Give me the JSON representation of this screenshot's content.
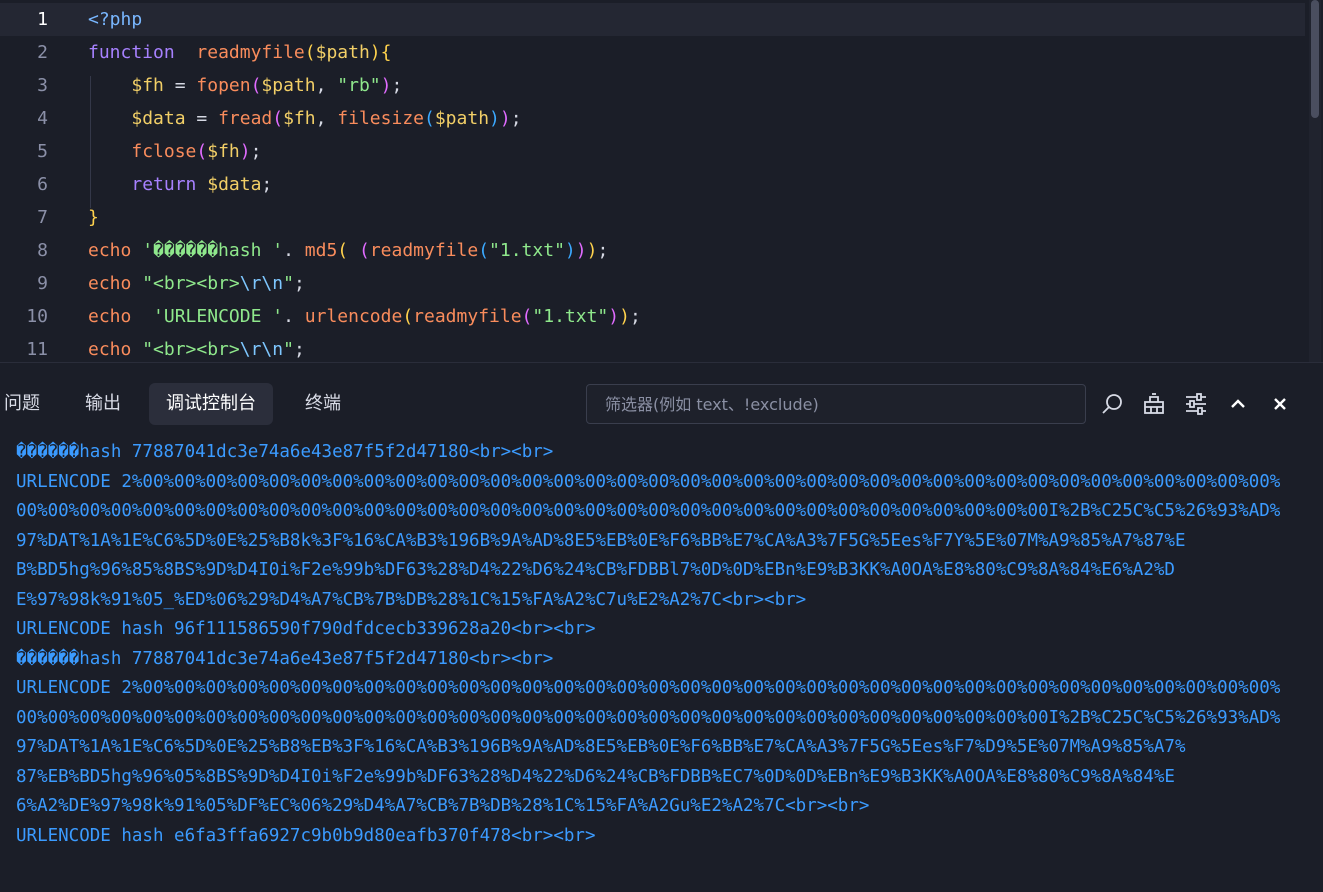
{
  "editor": {
    "current_line": 1,
    "lines": [
      {
        "n": "1",
        "tokens": [
          {
            "t": "<?php",
            "c": "tag"
          }
        ]
      },
      {
        "n": "2",
        "tokens": [
          {
            "t": "function",
            "c": "kw"
          },
          {
            "t": "  ",
            "c": "op"
          },
          {
            "t": "readmyfile",
            "c": "fn"
          },
          {
            "t": "(",
            "c": "b1"
          },
          {
            "t": "$path",
            "c": "var"
          },
          {
            "t": ")",
            "c": "b1"
          },
          {
            "t": "{",
            "c": "b1"
          }
        ]
      },
      {
        "n": "3",
        "tokens": [
          {
            "t": "    ",
            "c": "op"
          },
          {
            "t": "$fh",
            "c": "var"
          },
          {
            "t": " = ",
            "c": "op"
          },
          {
            "t": "fopen",
            "c": "fn"
          },
          {
            "t": "(",
            "c": "b2"
          },
          {
            "t": "$path",
            "c": "var"
          },
          {
            "t": ", ",
            "c": "op"
          },
          {
            "t": "\"rb\"",
            "c": "str"
          },
          {
            "t": ")",
            "c": "b2"
          },
          {
            "t": ";",
            "c": "op"
          }
        ]
      },
      {
        "n": "4",
        "tokens": [
          {
            "t": "    ",
            "c": "op"
          },
          {
            "t": "$data",
            "c": "var"
          },
          {
            "t": " = ",
            "c": "op"
          },
          {
            "t": "fread",
            "c": "fn"
          },
          {
            "t": "(",
            "c": "b2"
          },
          {
            "t": "$fh",
            "c": "var"
          },
          {
            "t": ", ",
            "c": "op"
          },
          {
            "t": "filesize",
            "c": "fn"
          },
          {
            "t": "(",
            "c": "b3"
          },
          {
            "t": "$path",
            "c": "var"
          },
          {
            "t": ")",
            "c": "b3"
          },
          {
            "t": ")",
            "c": "b2"
          },
          {
            "t": ";",
            "c": "op"
          }
        ]
      },
      {
        "n": "5",
        "tokens": [
          {
            "t": "    ",
            "c": "op"
          },
          {
            "t": "fclose",
            "c": "fn"
          },
          {
            "t": "(",
            "c": "b2"
          },
          {
            "t": "$fh",
            "c": "var"
          },
          {
            "t": ")",
            "c": "b2"
          },
          {
            "t": ";",
            "c": "op"
          }
        ]
      },
      {
        "n": "6",
        "tokens": [
          {
            "t": "    ",
            "c": "op"
          },
          {
            "t": "return",
            "c": "kw"
          },
          {
            "t": " ",
            "c": "op"
          },
          {
            "t": "$data",
            "c": "var"
          },
          {
            "t": ";",
            "c": "op"
          }
        ]
      },
      {
        "n": "7",
        "tokens": [
          {
            "t": "}",
            "c": "b1"
          }
        ]
      },
      {
        "n": "8",
        "tokens": [
          {
            "t": "echo",
            "c": "fn"
          },
          {
            "t": " ",
            "c": "op"
          },
          {
            "t": "'������hash '",
            "c": "str"
          },
          {
            "t": ". ",
            "c": "op"
          },
          {
            "t": "md5",
            "c": "fn"
          },
          {
            "t": "(",
            "c": "b1"
          },
          {
            "t": " ",
            "c": "op"
          },
          {
            "t": "(",
            "c": "b2"
          },
          {
            "t": "readmyfile",
            "c": "fn"
          },
          {
            "t": "(",
            "c": "b3"
          },
          {
            "t": "\"1.txt\"",
            "c": "str"
          },
          {
            "t": ")",
            "c": "b3"
          },
          {
            "t": ")",
            "c": "b2"
          },
          {
            "t": ")",
            "c": "b1"
          },
          {
            "t": ";",
            "c": "op"
          }
        ]
      },
      {
        "n": "9",
        "tokens": [
          {
            "t": "echo",
            "c": "fn"
          },
          {
            "t": " ",
            "c": "op"
          },
          {
            "t": "\"<br><br>",
            "c": "str"
          },
          {
            "t": "\\r\\n",
            "c": "esc"
          },
          {
            "t": "\"",
            "c": "str"
          },
          {
            "t": ";",
            "c": "op"
          }
        ]
      },
      {
        "n": "10",
        "tokens": [
          {
            "t": "echo",
            "c": "fn"
          },
          {
            "t": "  ",
            "c": "op"
          },
          {
            "t": "'URLENCODE '",
            "c": "str"
          },
          {
            "t": ". ",
            "c": "op"
          },
          {
            "t": "urlencode",
            "c": "fn"
          },
          {
            "t": "(",
            "c": "b1"
          },
          {
            "t": "readmyfile",
            "c": "fn"
          },
          {
            "t": "(",
            "c": "b2"
          },
          {
            "t": "\"1.txt\"",
            "c": "str"
          },
          {
            "t": ")",
            "c": "b2"
          },
          {
            "t": ")",
            "c": "b1"
          },
          {
            "t": ";",
            "c": "op"
          }
        ]
      },
      {
        "n": "11",
        "tokens": [
          {
            "t": "echo",
            "c": "fn"
          },
          {
            "t": " ",
            "c": "op"
          },
          {
            "t": "\"<br><br>",
            "c": "str"
          },
          {
            "t": "\\r\\n",
            "c": "esc"
          },
          {
            "t": "\"",
            "c": "str"
          },
          {
            "t": ";",
            "c": "op"
          }
        ]
      }
    ]
  },
  "panel": {
    "tabs": [
      {
        "label": "问题",
        "active": false
      },
      {
        "label": "输出",
        "active": false
      },
      {
        "label": "调试控制台",
        "active": true
      },
      {
        "label": "终端",
        "active": false
      }
    ],
    "filter": {
      "placeholder": "筛选器(例如 text、!exclude)",
      "value": ""
    },
    "actions": [
      "search-icon",
      "clear-console-icon",
      "settings-sliders-icon",
      "chevron-up-icon",
      "close-icon"
    ]
  },
  "console": {
    "lines": [
      "������hash 77887041dc3e74a6e43e87f5f2d47180<br><br>",
      "URLENCODE 2%00%00%00%00%00%00%00%00%00%00%00%00%00%00%00%00%00%00%00%00%00%00%00%00%00%00%00%00%00%00%00%00%00%00%00%00%",
      "00%00%00%00%00%00%00%00%00%00%00%00%00%00%00%00%00%00%00%00%00%00%00%00%00%00%00%00%00%00%00%00%00I%2B%C25C%C5%26%93%AD%",
      "97%DAT%1A%1E%C6%5D%0E%25%B8k%3F%16%CA%B3%196B%9A%AD%8E5%EB%0E%F6%BB%E7%CA%A3%7F5G%5Ees%F7Y%5E%07M%A9%85%A7%87%E",
      "B%BD5hg%96%85%8BS%9D%D4I0i%F2e%99b%DF63%28%D4%22%D6%24%CB%FDBBl7%0D%0D%EBn%E9%B3KK%A0OA%E8%80%C9%8A%84%E6%A2%D",
      "E%97%98k%91%05_%ED%06%29%D4%A7%CB%7B%DB%28%1C%15%FA%A2%C7u%E2%A2%7C<br><br>",
      "URLENCODE hash 96f111586590f790dfdcecb339628a20<br><br>",
      "������hash 77887041dc3e74a6e43e87f5f2d47180<br><br>",
      "URLENCODE 2%00%00%00%00%00%00%00%00%00%00%00%00%00%00%00%00%00%00%00%00%00%00%00%00%00%00%00%00%00%00%00%00%00%00%00%00%",
      "00%00%00%00%00%00%00%00%00%00%00%00%00%00%00%00%00%00%00%00%00%00%00%00%00%00%00%00%00%00%00%00%00I%2B%C25C%C5%26%93%AD%",
      "97%DAT%1A%1E%C6%5D%0E%25%B8%EB%3F%16%CA%B3%196B%9A%AD%8E5%EB%0E%F6%BB%E7%CA%A3%7F5G%5Ees%F7%D9%5E%07M%A9%85%A7%",
      "87%EB%BD5hg%96%05%8BS%9D%D4I0i%F2e%99b%DF63%28%D4%22%D6%24%CB%FDBB%EC7%0D%0D%EBn%E9%B3KK%A0OA%E8%80%C9%8A%84%E",
      "6%A2%DE%97%98k%91%05%DF%EC%06%29%D4%A7%CB%7B%DB%28%1C%15%FA%A2Gu%E2%A2%7C<br><br>",
      "URLENCODE hash e6fa3ffa6927c9b0b9d80eafb370f478<br><br>"
    ]
  }
}
